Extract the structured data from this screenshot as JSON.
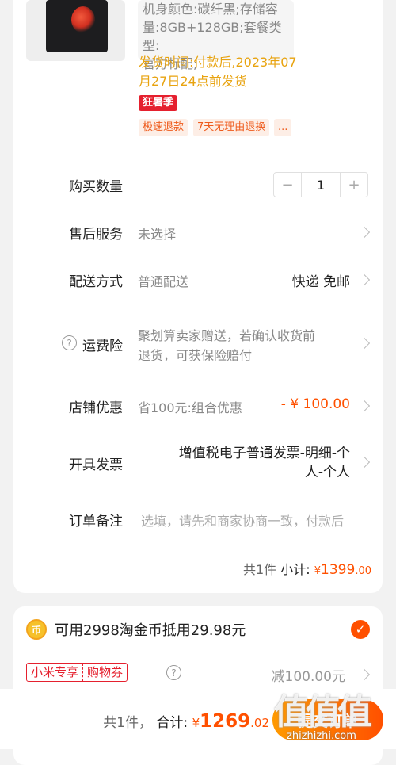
{
  "product": {
    "spec_lines": [
      "机身颜色:碳纤黑;存储容",
      "量:8GB+128GB;套餐类型:",
      "官方标配;"
    ],
    "ship_lines": [
      "发货时间:付款后,2023年07",
      "月27日24点前发货"
    ],
    "promo_tag": "狂暑季",
    "service_tags": [
      "极速退款",
      "7天无理由退换",
      "..."
    ]
  },
  "quantity": {
    "label": "购买数量",
    "minus": "−",
    "value": "1",
    "plus": "+"
  },
  "after_sale": {
    "label": "售后服务",
    "value": "未选择"
  },
  "delivery": {
    "label": "配送方式",
    "value": "普通配送",
    "method": "快递 免邮"
  },
  "freight_insurance": {
    "label": "运费险",
    "line1": "聚划算卖家赠送，若确认收货前",
    "line2": "退货，可获保险赔付"
  },
  "shop_discount": {
    "label": "店铺优惠",
    "value": "省100元:组合优惠",
    "amount": "- ¥ 100.00"
  },
  "invoice": {
    "label": "开具发票",
    "line1": "增值税电子普通发票-明细-个",
    "line2": "人-个人"
  },
  "note": {
    "label": "订单备注",
    "placeholder": "选填，请先和商家协商一致，付款后"
  },
  "subtotal": {
    "count": "共1件",
    "label": "小计:",
    "currency": "¥",
    "int": "1399",
    "dec": ".00"
  },
  "coins": {
    "icon_text": "币",
    "text": "可用2998淘金币抵用29.98元"
  },
  "voucher": {
    "tag_left": "小米专享",
    "tag_right": "购物券",
    "amount": "减100.00元"
  },
  "footer": {
    "count": "共1件，",
    "label": "合计:",
    "currency": "¥",
    "int": "1269",
    "dec": ".02",
    "submit": "提交订单"
  },
  "watermark": {
    "text": "值值值",
    "url": "zhizhizhi.com"
  },
  "colors": {
    "accent": "#ff5000",
    "ship": "#e8a30f",
    "promo": "#e5202e"
  }
}
